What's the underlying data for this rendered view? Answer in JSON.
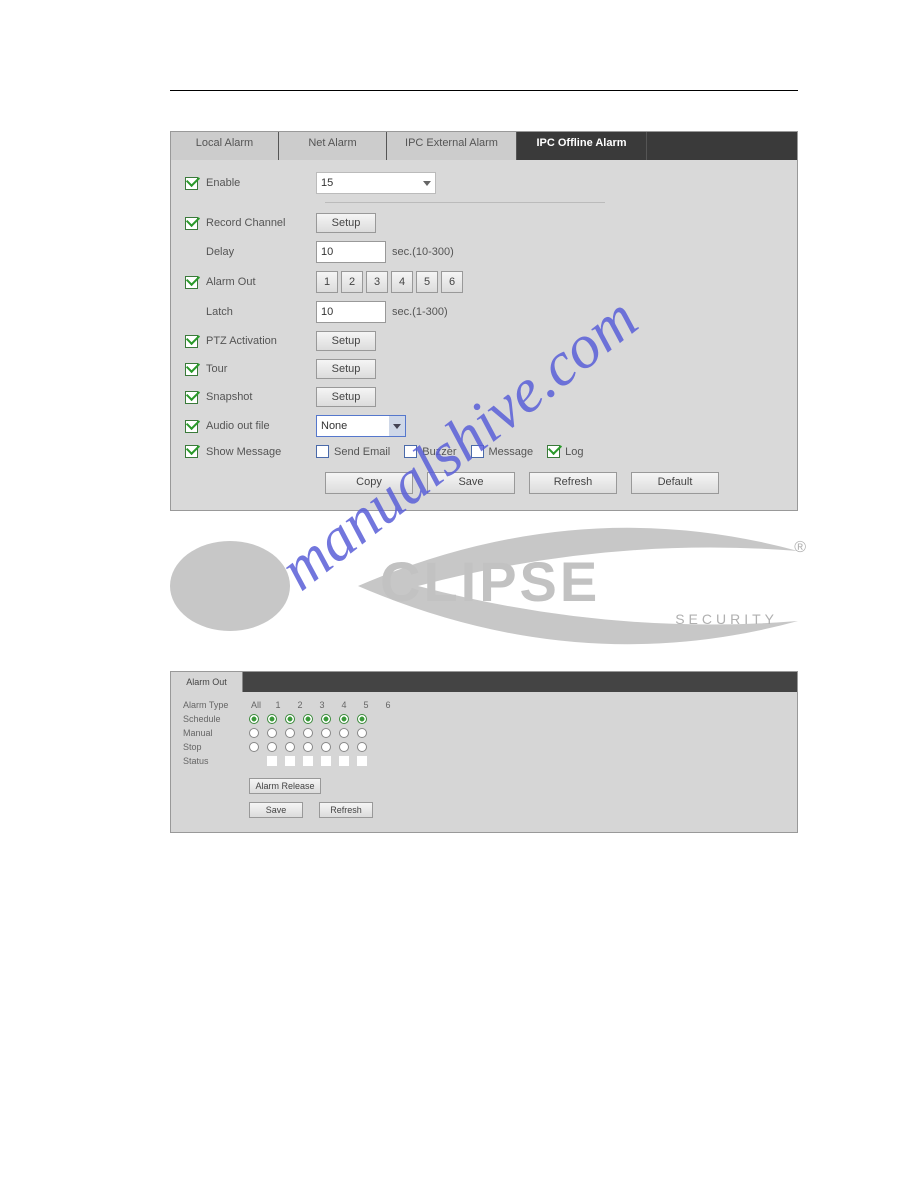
{
  "panel1": {
    "tabs": [
      "Local Alarm",
      "Net Alarm",
      "IPC External Alarm",
      "IPC Offline Alarm"
    ],
    "active_tab": 3,
    "enable_label": "Enable",
    "enable_value": "15",
    "record_channel_label": "Record Channel",
    "setup_label": "Setup",
    "delay_label": "Delay",
    "delay_value": "10",
    "delay_unit": "sec.(10-300)",
    "alarm_out_label": "Alarm Out",
    "alarm_out_numbers": [
      "1",
      "2",
      "3",
      "4",
      "5",
      "6"
    ],
    "latch_label": "Latch",
    "latch_value": "10",
    "latch_unit": "sec.(1-300)",
    "ptz_label": "PTZ Activation",
    "tour_label": "Tour",
    "snapshot_label": "Snapshot",
    "audio_label": "Audio out file",
    "audio_value": "None",
    "show_message_label": "Show Message",
    "extra_checks": {
      "send_email": "Send Email",
      "buzzer": "Buzzer",
      "message": "Message",
      "log": "Log"
    },
    "actions": {
      "copy": "Copy",
      "save": "Save",
      "refresh": "Refresh",
      "default": "Default"
    }
  },
  "logo": {
    "big": "CLIPSE",
    "small": "SECURITY",
    "reg": "®"
  },
  "watermark": "manualshive.com",
  "panel2": {
    "tab": "Alarm Out",
    "alarm_type_label": "Alarm Type",
    "cols": [
      "All",
      "1",
      "2",
      "3",
      "4",
      "5",
      "6"
    ],
    "rows": {
      "schedule": "Schedule",
      "manual": "Manual",
      "stop": "Stop",
      "status": "Status"
    },
    "alarm_release": "Alarm Release",
    "save": "Save",
    "refresh": "Refresh"
  }
}
